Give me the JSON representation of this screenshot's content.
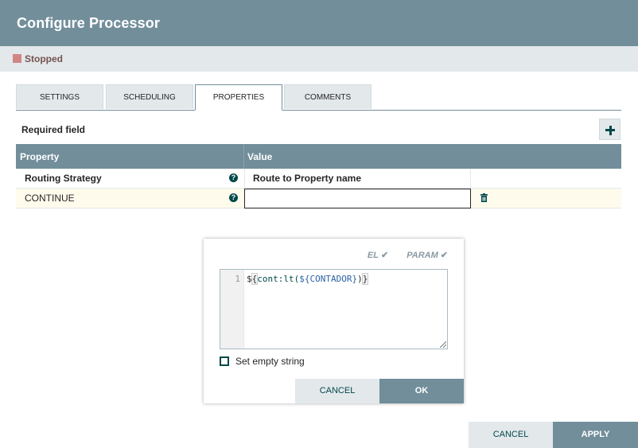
{
  "dialog": {
    "title": "Configure Processor",
    "status": {
      "label": "Stopped",
      "icon": "stopped-square-icon",
      "color": "#d18686"
    }
  },
  "tabs": [
    {
      "label": "SETTINGS",
      "active": false
    },
    {
      "label": "SCHEDULING",
      "active": false
    },
    {
      "label": "PROPERTIES",
      "active": true
    },
    {
      "label": "COMMENTS",
      "active": false
    }
  ],
  "properties_panel": {
    "required_label": "Required field",
    "add_button_icon": "plus-icon",
    "columns": {
      "property": "Property",
      "value": "Value"
    },
    "rows": [
      {
        "name": "Routing Strategy",
        "value": "Route to Property name",
        "required": true,
        "help_icon": "question-circle-icon"
      },
      {
        "name": "CONTINUE",
        "value": "",
        "required": false,
        "help_icon": "question-circle-icon",
        "delete_icon": "trash-icon"
      }
    ]
  },
  "value_editor": {
    "flags": [
      {
        "label": "EL",
        "icon": "checkmark-icon"
      },
      {
        "label": "PARAM",
        "icon": "checkmark-icon"
      }
    ],
    "line_number": "1",
    "code": {
      "prefix": "$",
      "open_brace": "{",
      "fn": "cont:lt(",
      "var": "${CONTADOR}",
      "close_paren": ")",
      "close_brace": "}"
    },
    "empty_string_label": "Set empty string",
    "empty_string_checked": false,
    "cancel_label": "CANCEL",
    "ok_label": "OK"
  },
  "footer": {
    "cancel_label": "CANCEL",
    "apply_label": "APPLY"
  },
  "colors": {
    "header": "#728e9b",
    "accent_dark": "#004849",
    "status_bar": "#e3e8eb",
    "selected_row": "#fffbec"
  }
}
